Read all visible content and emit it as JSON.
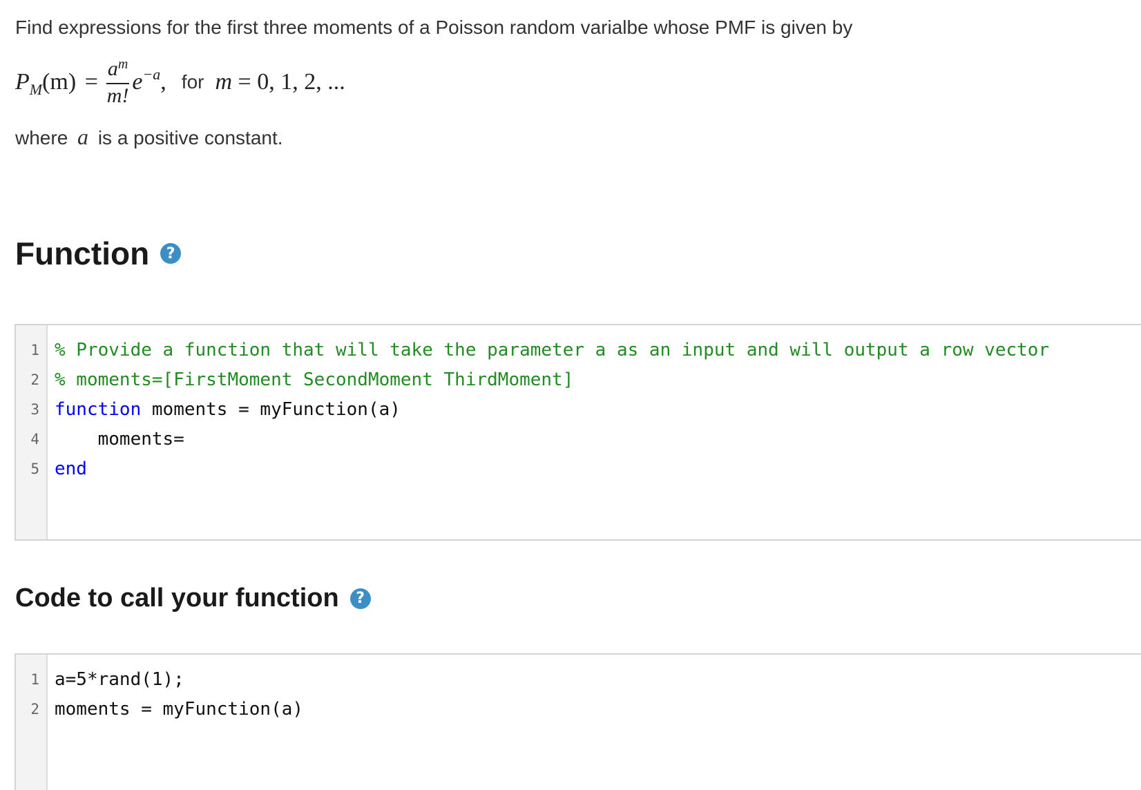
{
  "problem": {
    "prompt": "Find expressions for the first three moments of a Poisson random varialbe whose PMF is given by",
    "formula": {
      "lhs_symbol": "P",
      "lhs_subscript": "M",
      "lhs_arg": "(m)",
      "equals": "=",
      "numerator": "a",
      "numerator_exp": "m",
      "denominator": "m!",
      "exp_base": "e",
      "exp_power": "−a",
      "comma": ",",
      "for_word": "for",
      "domain_var": "m",
      "domain_values": "= 0, 1, 2, ..."
    },
    "where_prefix": "where",
    "where_var": "a",
    "where_suffix": "is a positive constant."
  },
  "function_section": {
    "title": "Function",
    "help_icon": "?",
    "editor": {
      "line_numbers": [
        "1",
        "2",
        "3",
        "4",
        "5"
      ],
      "lines": [
        {
          "segments": [
            {
              "type": "comment",
              "text": "% Provide a function that will take the parameter a as an input and will output a row vector"
            }
          ]
        },
        {
          "segments": [
            {
              "type": "comment",
              "text": "% moments=[FirstMoment SecondMoment ThirdMoment]"
            }
          ]
        },
        {
          "segments": [
            {
              "type": "keyword",
              "text": "function"
            },
            {
              "type": "plain",
              "text": " moments = myFunction(a)"
            }
          ]
        },
        {
          "segments": [
            {
              "type": "plain",
              "text": "    moments="
            }
          ]
        },
        {
          "segments": [
            {
              "type": "keyword",
              "text": "end"
            }
          ]
        }
      ]
    }
  },
  "call_section": {
    "title": "Code to call your function",
    "help_icon": "?",
    "editor": {
      "line_numbers": [
        "1",
        "2"
      ],
      "lines": [
        {
          "segments": [
            {
              "type": "plain",
              "text": "a=5*rand(1);"
            }
          ]
        },
        {
          "segments": [
            {
              "type": "plain",
              "text": "moments = myFunction(a)"
            }
          ]
        }
      ]
    }
  },
  "colors": {
    "comment": "#228b22",
    "keyword": "#0000ff",
    "help_icon_bg": "#3b8fc4"
  }
}
